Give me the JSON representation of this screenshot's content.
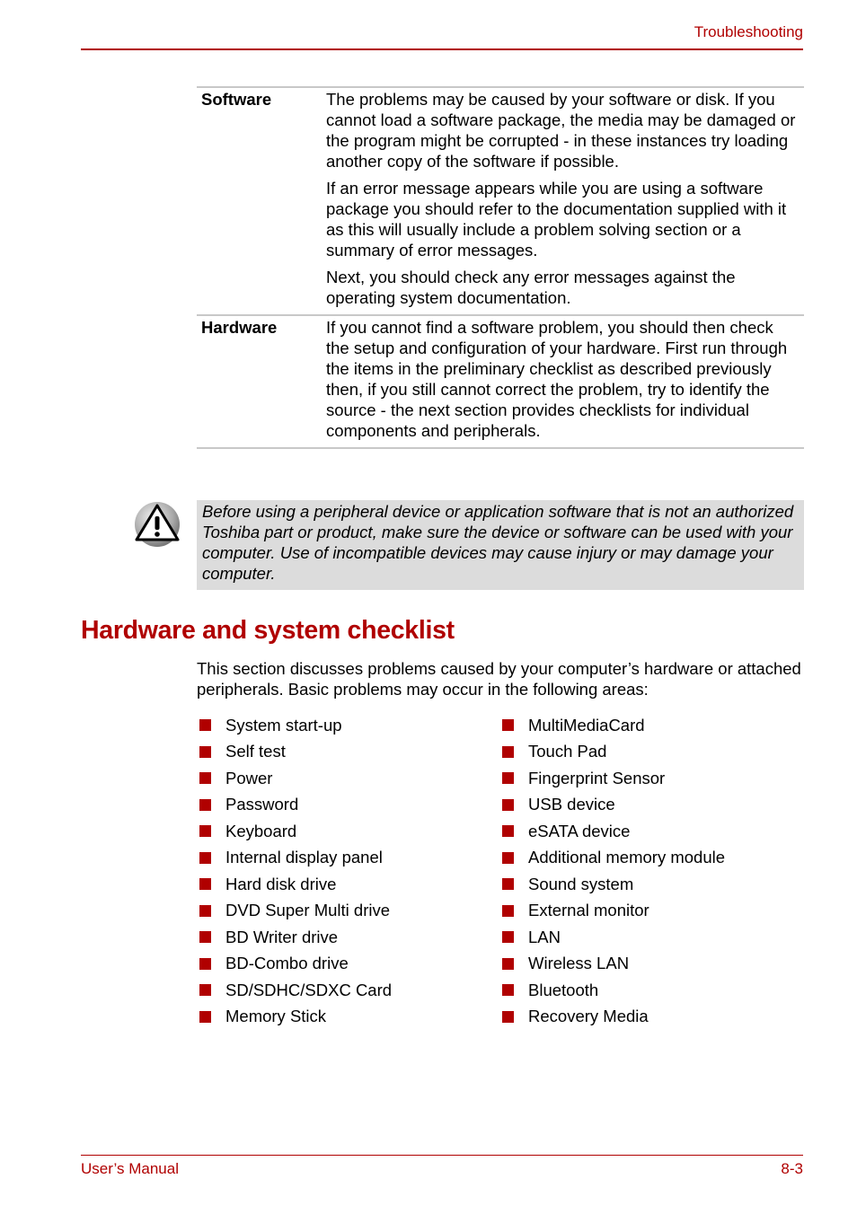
{
  "header": {
    "section": "Troubleshooting"
  },
  "table": {
    "rows": [
      {
        "term": "Software",
        "paragraphs": [
          "The problems may be caused by your software or disk. If you cannot load a software package, the media may be damaged or the program might be corrupted - in these instances try loading another copy of the software if possible.",
          "If an error message appears while you are using a software package you should refer to the documentation supplied with it as this will usually include a problem solving section or a summary of error messages.",
          "Next, you should check any error messages against the operating system documentation."
        ]
      },
      {
        "term": "Hardware",
        "paragraphs": [
          "If you cannot find a software problem, you should then check the setup and configuration of your hardware. First run through the items in the preliminary checklist as described previously then, if you still cannot correct the problem, try to identify the source - the next section provides checklists for individual components and peripherals."
        ]
      }
    ]
  },
  "note": {
    "icon": "warning-icon",
    "text": "Before using a peripheral device or application software that is not an authorized Toshiba part or product, make sure the device or software can be used with your computer. Use of incompatible devices may cause injury or may damage your computer."
  },
  "section": {
    "heading": "Hardware and system checklist",
    "intro": "This section discusses problems caused by your computer’s hardware or attached peripherals. Basic problems may occur in the following areas:",
    "list_col1": [
      "System start-up",
      "Self test",
      "Power",
      "Password",
      "Keyboard",
      "Internal display panel",
      "Hard disk drive",
      "DVD Super Multi drive",
      "BD Writer drive",
      "BD-Combo drive",
      "SD/SDHC/SDXC Card",
      "Memory Stick"
    ],
    "list_col2": [
      "MultiMediaCard",
      "Touch Pad",
      "Fingerprint Sensor",
      "USB device",
      "eSATA device",
      "Additional memory module",
      "Sound system",
      "External monitor",
      "LAN",
      "Wireless LAN",
      "Bluetooth",
      "Recovery Media"
    ]
  },
  "footer": {
    "left": "User’s Manual",
    "page": "8-3"
  },
  "colors": {
    "accent": "#b00000",
    "note_bg": "#dcdcdc",
    "rule_gray": "#c8c8c8"
  }
}
